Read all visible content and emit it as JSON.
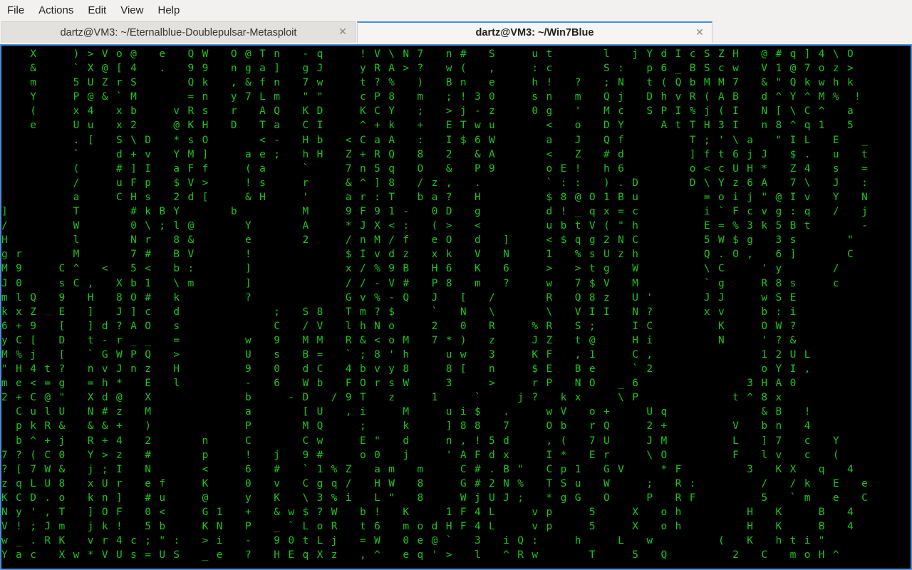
{
  "menubar": {
    "items": [
      "File",
      "Actions",
      "Edit",
      "View",
      "Help"
    ]
  },
  "tabs": [
    {
      "label": "dartz@VM3: ~/Eternalblue-Doublepulsar-Metasploit",
      "active": false
    },
    {
      "label": "dartz@VM3: ~/Win7Blue",
      "active": true
    }
  ],
  "terminal": {
    "colors": {
      "matrix_green": "#19c519",
      "highlight": "#eaeaea",
      "background": "#000000",
      "focus_border": "#4a90d9"
    },
    "matrix_lines": [
      "    X     ) > V o @   e   Q W   O @ T n   - q     ! V \\ N 7   n #   S     u t       l   j Y d I c S Z H   @ # q ] 4 \\ O",
      "    &     ` X @ [ 4   .   9 9   n g a ]   g J     y R A > ?   w (   ,     : c       S :   p 6 _ B S c w   V 1 @ 7 o z >",
      "    m     5 U Z r S       Q k   , & f n   7 w     t ? %   )   B n   e     h !   ?   ; N   t ( Q b M M 7   & \" Q k w h k",
      "    Y     P @ & ` M       = n   y 7 L m   \" \"     c P 8   m   ; ! 3 0     s n   m   Q j   D h v R ( A B   d ^ Y ^ M %  ! ",
      "    (     x 4   x b     v R s   r   A Q   K D     K C Y   ;   > j - z     0 g   '   M c   S P I % j ( I   N [ \\ C ^   a",
      "    e     U u   x 2     @ K H   D   T a   C I     ^ + k   +   E T w u       <   o   D Y     A t T H 3 I   n 8 ^ q 1   5",
      "          . [   S \\ D   * s O       < -   H b   < C a A   :   I $ 6 W       a   J   Q f         T ; ' \\ a   \" I L   E   _",
      "          `     d + v   Y M ]     a e ;   h H   Z + R Q   8   2   & A       <   Z   # d         ] f t 6 j J   $ .   u   t",
      "          (     # ] I   a F f     ( a     `     7 n 5 q   O   &   P 9       o E !   h 6         o < c U H *   Z 4   s   =",
      "          /     u F p   $ V >     ! s     r     & ^ ] 8   / z ,   .         ` : :   ) . D       D \\ Y z 6 A   7 \\   J   :",
      "          a     C H s   2 d [     & H     '     a r : T   b a ?   H         $ 8 @ O 1 B u         = o i j \" @ I v   Y   N",
      "]         T       # k B Y       b         M     9 F 9 1 -   0 D   g         d ! _ q x = c         i ` F c v g : q   /   j",
      "/         W       0 \\ ; l @       Y       A     * J X < :   ( >   <         u b t V ( \" h         E = % 3 k 5 B t       -",
      "H         l       N r   8 &       e       2     / n M / f   e O   d   ]     < $ q g 2 N C         5 W $ g   3 s       \"",
      "g r       M       7 #   B V       !             $ I v d z   x k   V   N     1   % s U z h         Q . O ,   6 ]       C",
      "M 9     C ^   <   5 <   b :       ]             x / % 9 B   H 6   K   6     >   > t g   W         \\ C     ' y       /",
      "J 0     s C ,   X b 1   \\ m       ]             / / - V #   P 8   m   ?     w   7 $ V   M         ` g     R 8 s     c",
      "m l Q   9   H   8 O #   k         ?             G v % - Q   J   [   /       R   Q 8 z   U '       J J     w S E",
      "k x Z   E   ]   J ] c   d             ;   S 8   T m ? $     `   N   \\       \\   V I I   N ?       x v     b : i",
      "6 + 9   [   ] d ? A O   s             C   / V   l h N o     2   0   R     % R   S ;     I C         K     O W ?",
      "y C [   D   t - r _ _   =         w   9   M M   R & < o M   7 * )   z     J Z   t @     H i         N     ' ? &",
      "M % j   [   ` G W P Q   >         U   s   B =   ` ; 8 ' h     u w   3     K F   , 1     C ,               1 2 U L",
      "\" H 4 t ?   n v J n z   H         9   0   d C   4 b v y 8     8 [   n     $ E   B e     ` 2               o Y I ,",
      "m e < = g   = h *   E   l         -   6   W b   F O r s W     3     >     r P   N O   _ 6               3 H A 0",
      "2 + C @ \"   X d @   X             b     - D   / 9 T   z     1     `     j ?   k x     \\ P             t ^ 8 x",
      "  C u l U   N # z   M             a       [ U   , i     M     u i $   .     w V   o +     U q             & B   !",
      "  p k R &   & & +   )             P       M Q     ;     k     ] 8 8   7     O b   r Q     2 +         V   b n   4",
      "  b ^ + j   R + 4   2       n     C       C w     E \"   d     n , ! 5 d     , (   7 U     J M         L   ] 7   c   Y",
      "7 ? ( C 0   Y > z   #       p     !   j   9 #     o 0   j     ' A F d x     I *   E r     \\ O         F   l v   c   (",
      "? [ 7 W &   j ; I   N       <     6   #   ` 1 % Z   a m   m     C # . B \"   C p 1   G V     * F         3   K X   q   4",
      "z q L U 8   x U r   e f     K     0   v   C g q /   H W   8     G # 2 N %   T S u   W     ;   R :         /   / k   E   e",
      "K C D . o   k n ]   # u     @     y   K   \\ 3 % i   L \"   8     W j U J ;   * g G   O     P   R F         5   ` m   e   C",
      "N y ' , T   ] O F   0 <     G 1   +   & w $ ? W   b !   K     1 F 4 L     v p     5     X   o h         H   K     B   4",
      "V ! ; J m   j k !   5 b     K N   P   _ ` L o R   t 6   m o d H F 4 L     v p     5     X   o h         H   K     B   4",
      "w _ . R K   v r 4 c ; \" :   > i   -   9 0 t L j   = W   0 e @ `   3   i Q :     h     L   w         (   K   h t i \"",
      "Y a c   X w * V U s = U S   _ e   ?   H E q X z   , ^   e q ' >   l   ^ R w       T     5   Q         2   C   m o H ^"
    ]
  }
}
